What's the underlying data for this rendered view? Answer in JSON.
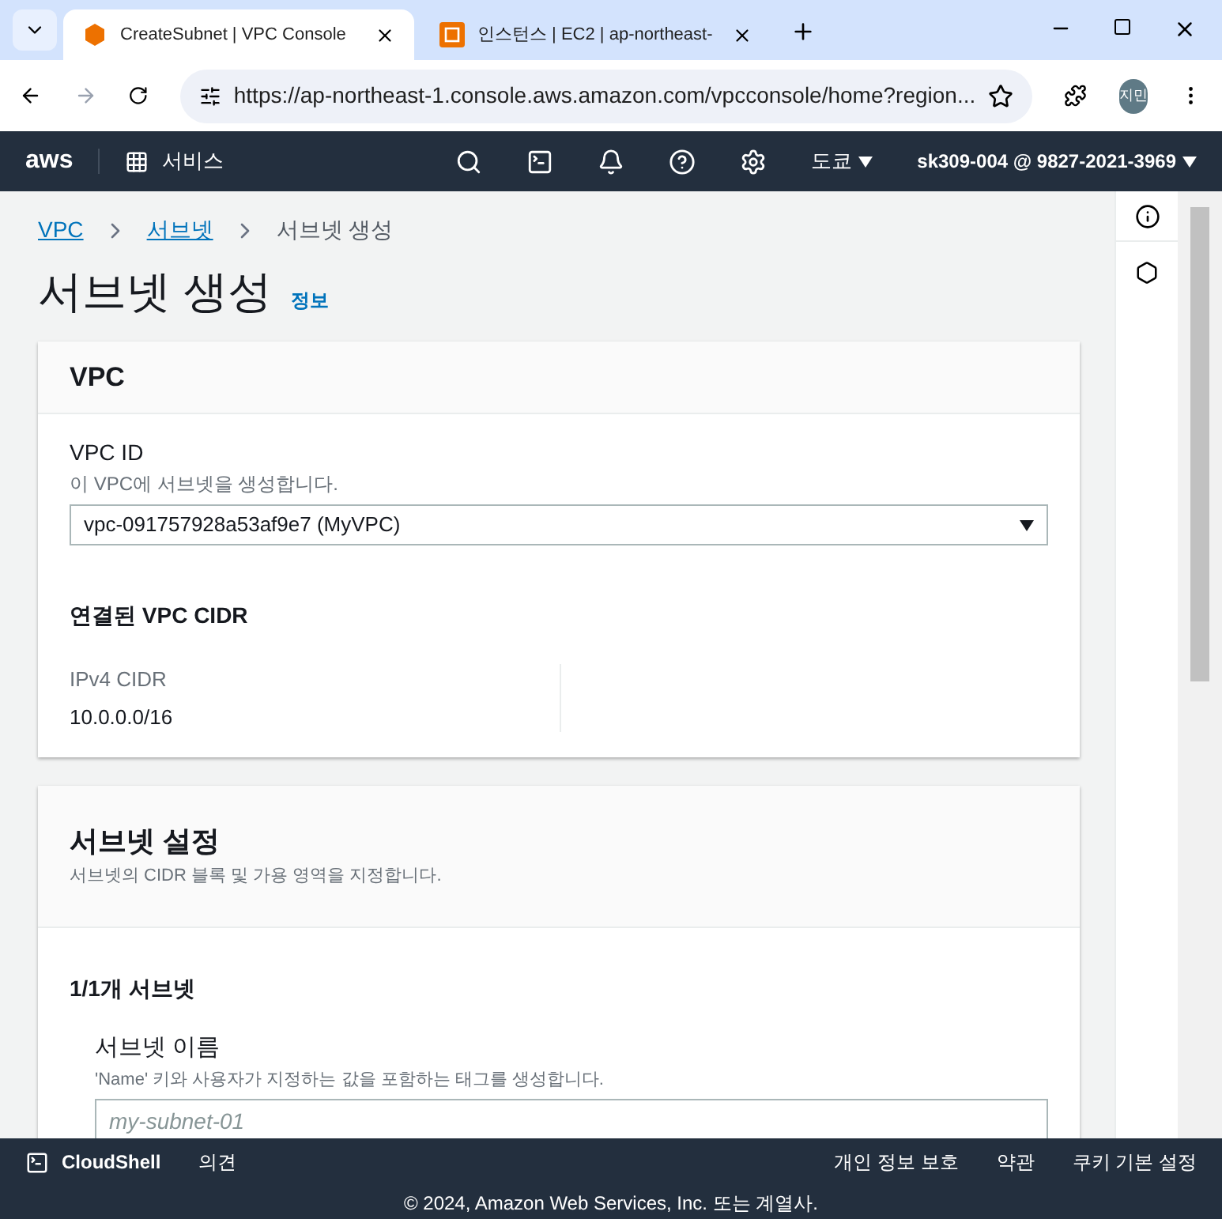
{
  "browser": {
    "tabs": [
      {
        "title": "CreateSubnet | VPC Console",
        "selected": true,
        "kind": "vpc"
      },
      {
        "title": "인스턴스 | EC2 | ap-northeast-",
        "selected": false,
        "kind": "ec2"
      }
    ],
    "url": "https://ap-northeast-1.console.aws.amazon.com/vpcconsole/home?region...",
    "profile": "지민"
  },
  "nav": {
    "logo": "aws",
    "services": "서비스",
    "region": "도쿄",
    "account": "sk309-004 @ 9827-2021-3969"
  },
  "breadcrumbs": [
    {
      "label": "VPC",
      "link": true
    },
    {
      "label": "서브넷",
      "link": true
    },
    {
      "label": "서브넷 생성",
      "link": false
    }
  ],
  "page": {
    "title": "서브넷 생성",
    "info": "정보"
  },
  "vpc_card": {
    "title": "VPC",
    "field_label": "VPC ID",
    "field_hint": "이 VPC에 서브넷을 생성합니다.",
    "field_value": "vpc-091757928a53af9e7 (MyVPC)",
    "cidr_title": "연결된 VPC CIDR",
    "cidr_label": "IPv4 CIDR",
    "cidr_value": "10.0.0.0/16"
  },
  "subnet_card": {
    "title": "서브넷 설정",
    "description": "서브넷의 CIDR 블록 및 가용 영역을 지정합니다.",
    "count": "1/1개 서브넷",
    "name_label": "서브넷 이름",
    "name_hint": "'Name' 키와 사용자가 지정하는 값을 포함하는 태그를 생성합니다.",
    "name_placeholder": "my-subnet-01"
  },
  "footer": {
    "cloudshell": "CloudShell",
    "feedback": "의견",
    "links": [
      "개인 정보 보호",
      "약관",
      "쿠키 기본 설정"
    ],
    "copyright": "© 2024, Amazon Web Services, Inc. 또는 계열사."
  }
}
